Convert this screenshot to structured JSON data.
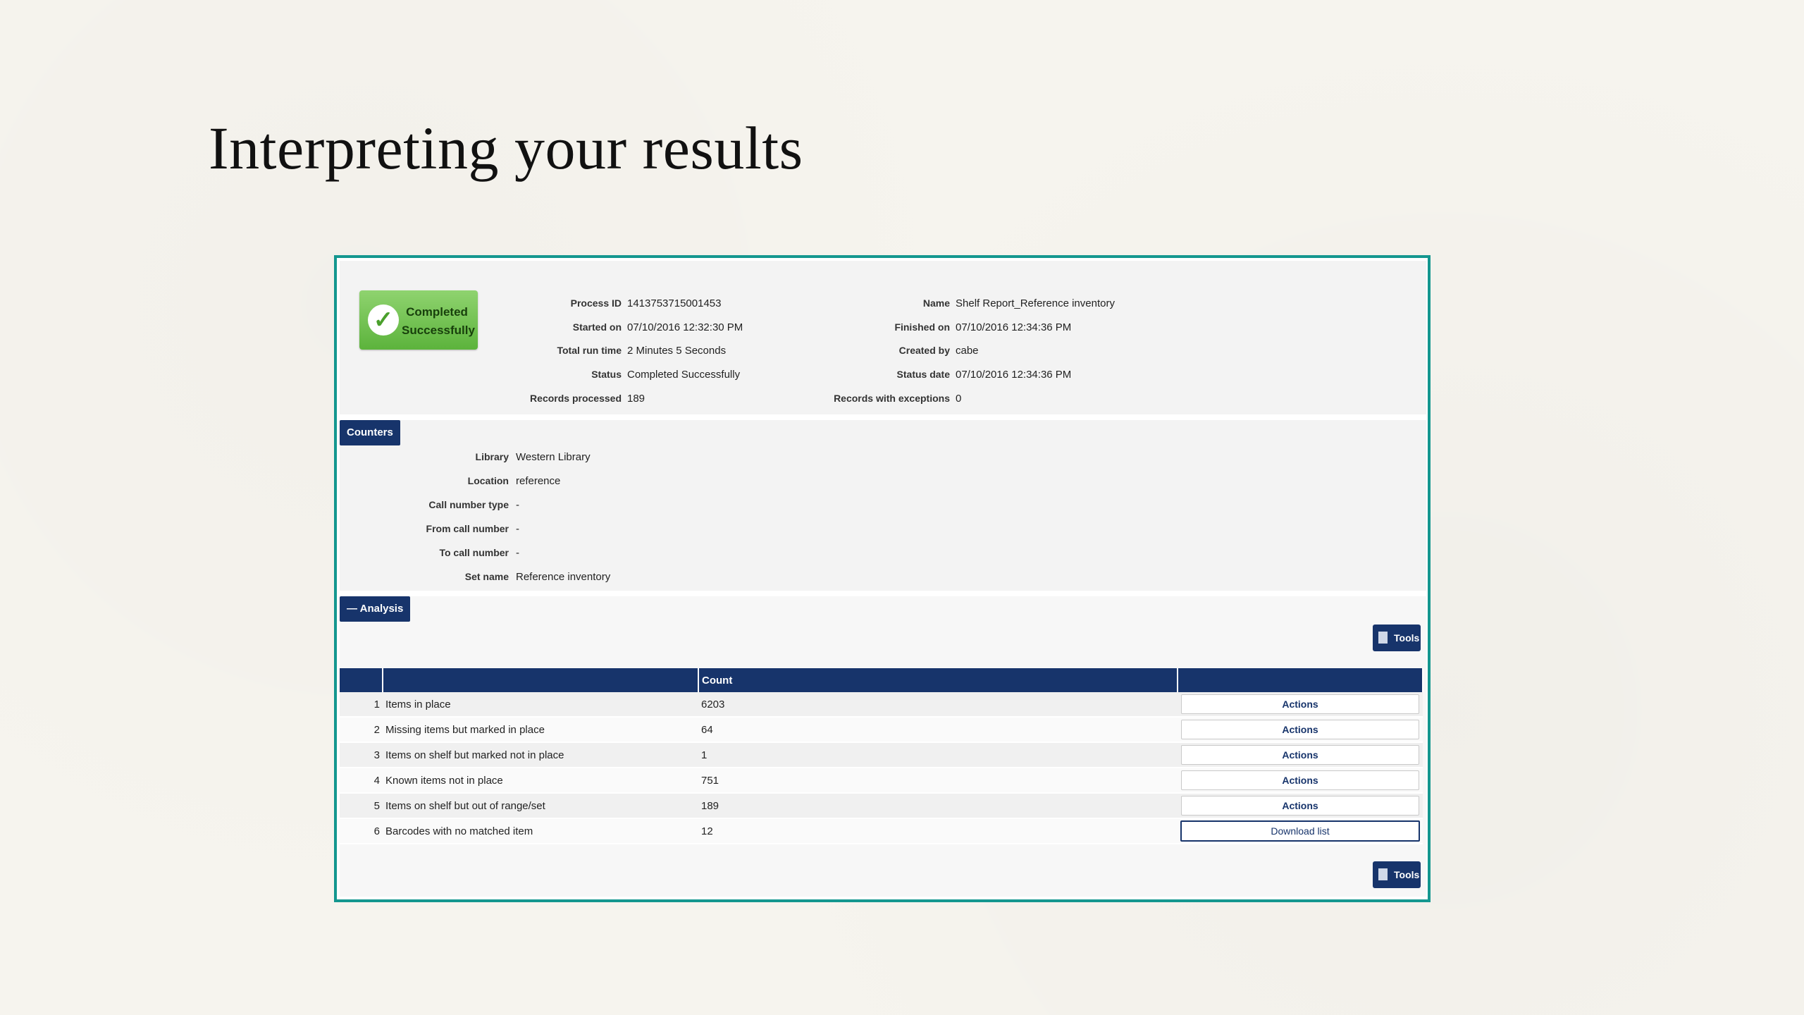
{
  "slide": {
    "title": "Interpreting your results"
  },
  "status_badge": {
    "label_line1": "Completed",
    "label_line2": "Successfully",
    "icon": "check-icon",
    "color": "#5cb33c"
  },
  "process": {
    "left": [
      {
        "key": "Process ID",
        "value": "1413753715001453"
      },
      {
        "key": "Started on",
        "value": "07/10/2016 12:32:30 PM"
      },
      {
        "key": "Total run time",
        "value": "2 Minutes 5 Seconds"
      },
      {
        "key": "Status",
        "value": "Completed Successfully"
      },
      {
        "key": "Records processed",
        "value": "189"
      }
    ],
    "right": [
      {
        "key": "Name",
        "value": "Shelf Report_Reference inventory"
      },
      {
        "key": "Finished on",
        "value": "07/10/2016 12:34:36 PM"
      },
      {
        "key": "Created by",
        "value": "cabe"
      },
      {
        "key": "Status date",
        "value": "07/10/2016 12:34:36 PM"
      },
      {
        "key": "Records with exceptions",
        "value": "0"
      }
    ]
  },
  "counters": {
    "tab_label": "Counters",
    "fields": [
      {
        "key": "Library",
        "value": "Western Library"
      },
      {
        "key": "Location",
        "value": "reference"
      },
      {
        "key": "Call number type",
        "value": "-"
      },
      {
        "key": "From call number",
        "value": "-"
      },
      {
        "key": "To call number",
        "value": "-"
      },
      {
        "key": "Set name",
        "value": "Reference inventory"
      }
    ]
  },
  "analysis": {
    "tab_label": "— Analysis",
    "tools_label": "Tools",
    "columns": [
      "",
      "",
      "Count",
      ""
    ],
    "rows": [
      {
        "index": "1",
        "label": "Items in place",
        "count": "6203",
        "action": "Actions"
      },
      {
        "index": "2",
        "label": "Missing items but marked in place",
        "count": "64",
        "action": "Actions"
      },
      {
        "index": "3",
        "label": "Items on shelf but marked not in place",
        "count": "1",
        "action": "Actions"
      },
      {
        "index": "4",
        "label": "Known items not in place",
        "count": "751",
        "action": "Actions"
      },
      {
        "index": "5",
        "label": "Items on shelf but out of range/set",
        "count": "189",
        "action": "Actions"
      },
      {
        "index": "6",
        "label": "Barcodes with no matched item",
        "count": "12",
        "action": "Download list"
      }
    ]
  },
  "colors": {
    "frame": "#14978f",
    "header": "#17346b"
  }
}
